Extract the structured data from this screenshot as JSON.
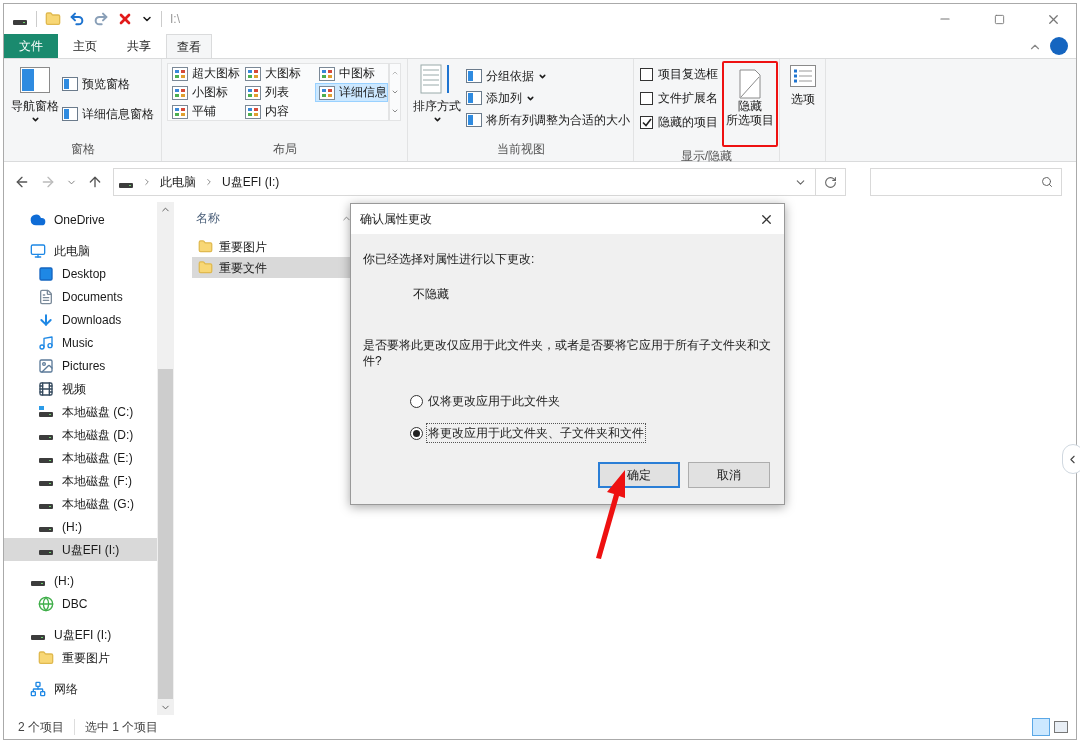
{
  "title_bar": {
    "path": "I:\\"
  },
  "ribbon_tabs": [
    {
      "label": "文件",
      "kind": "file",
      "selected": false
    },
    {
      "label": "主页",
      "kind": "tab",
      "selected": false
    },
    {
      "label": "共享",
      "kind": "tab",
      "selected": false
    },
    {
      "label": "查看",
      "kind": "tab",
      "selected": true
    }
  ],
  "ribbon": {
    "panes": {
      "label": "窗格",
      "nav_pane": "导航窗格",
      "preview_pane": "预览窗格",
      "details_pane": "详细信息窗格"
    },
    "layout": {
      "label": "布局",
      "options": [
        {
          "label": "超大图标",
          "selected": false
        },
        {
          "label": "大图标",
          "selected": false
        },
        {
          "label": "中图标",
          "selected": false
        },
        {
          "label": "小图标",
          "selected": false
        },
        {
          "label": "列表",
          "selected": false
        },
        {
          "label": "详细信息",
          "selected": true
        },
        {
          "label": "平铺",
          "selected": false
        },
        {
          "label": "内容",
          "selected": false
        }
      ]
    },
    "current_view": {
      "label": "当前视图",
      "sort_by": "排序方式",
      "group_by": "分组依据",
      "add_columns": "添加列",
      "size_all_columns": "将所有列调整为合适的大小"
    },
    "show_hide": {
      "label": "显示/隐藏",
      "checkboxes": [
        {
          "label": "项目复选框",
          "checked": false
        },
        {
          "label": "文件扩展名",
          "checked": false
        },
        {
          "label": "隐藏的项目",
          "checked": true
        }
      ],
      "hide_selected": [
        "隐藏",
        "所选项目"
      ]
    },
    "options": "选项"
  },
  "address_bar": {
    "crumbs": [
      "此电脑",
      "U盘EFI (I:)"
    ]
  },
  "navigation": [
    {
      "label": "OneDrive",
      "kind": "cloud",
      "selected": false
    },
    {
      "label": "此电脑",
      "kind": "pc",
      "selected": false,
      "children": [
        {
          "label": "Desktop",
          "kind": "desktop",
          "selected": false
        },
        {
          "label": "Documents",
          "kind": "documents",
          "selected": false
        },
        {
          "label": "Downloads",
          "kind": "downloads",
          "selected": false
        },
        {
          "label": "Music",
          "kind": "music",
          "selected": false
        },
        {
          "label": "Pictures",
          "kind": "pictures",
          "selected": false
        },
        {
          "label": "视频",
          "kind": "video",
          "selected": false
        },
        {
          "label": "本地磁盘 (C:)",
          "kind": "system-drive",
          "selected": false
        },
        {
          "label": "本地磁盘 (D:)",
          "kind": "drive",
          "selected": false
        },
        {
          "label": "本地磁盘 (E:)",
          "kind": "drive",
          "selected": false
        },
        {
          "label": "本地磁盘 (F:)",
          "kind": "drive",
          "selected": false
        },
        {
          "label": "本地磁盘 (G:)",
          "kind": "drive",
          "selected": false
        },
        {
          "label": "(H:)",
          "kind": "drive",
          "selected": false
        },
        {
          "label": "U盘EFI (I:)",
          "kind": "drive",
          "selected": true
        }
      ]
    },
    {
      "label": "(H:)",
      "kind": "drive",
      "selected": false,
      "children": [
        {
          "label": "DBC",
          "kind": "globe",
          "selected": false
        }
      ]
    },
    {
      "label": "U盘EFI (I:)",
      "kind": "drive",
      "selected": false,
      "children": [
        {
          "label": "重要图片",
          "kind": "folder",
          "selected": false
        }
      ]
    },
    {
      "label": "网络",
      "kind": "network",
      "selected": false
    }
  ],
  "file_list": {
    "column": "名称",
    "rows": [
      {
        "name": "重要图片",
        "selected": false
      },
      {
        "name": "重要文件",
        "selected": true
      }
    ]
  },
  "dialog": {
    "title": "确认属性更改",
    "intro": "你已经选择对属性进行以下更改:",
    "change": "不隐藏",
    "question": "是否要将此更改仅应用于此文件夹，或者是否要将它应用于所有子文件夹和文件?",
    "options": [
      {
        "label": "仅将更改应用于此文件夹",
        "selected": false
      },
      {
        "label": "将更改应用于此文件夹、子文件夹和文件",
        "selected": true
      }
    ],
    "buttons": [
      {
        "label": "确定",
        "kind": "default"
      },
      {
        "label": "取消",
        "kind": "normal"
      }
    ]
  },
  "status_bar": {
    "count": "2 个项目",
    "selection": "选中 1 个项目"
  }
}
